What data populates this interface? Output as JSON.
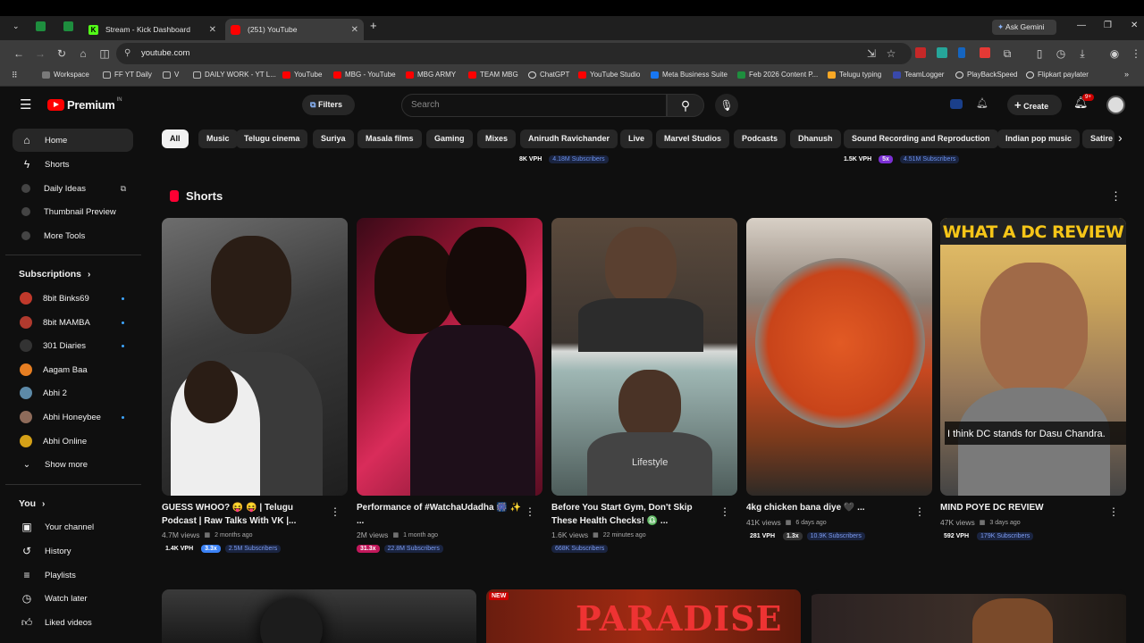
{
  "browser": {
    "tabs": [
      {
        "label": "Stream - Kick Dashboard"
      },
      {
        "label": "(251) YouTube"
      }
    ],
    "ask_gemini": "Ask Gemini",
    "url": "youtube.com",
    "bookmarks": [
      "Workspace",
      "FF YT Daily",
      "V",
      "DAILY WORK - YT L...",
      "YouTube",
      "MBG - YouTube",
      "MBG ARMY",
      "TEAM MBG",
      "ChatGPT",
      "YouTube Studio",
      "Meta Business Suite",
      "Feb 2026 Content P...",
      "Telugu typing",
      "TeamLogger",
      "PlayBackSpeed",
      "Flipkart paylater"
    ]
  },
  "header": {
    "logo_text": "Premium",
    "logo_sup": "IN",
    "filters_label": "Filters",
    "search_placeholder": "Search",
    "create_label": "Create",
    "notif_badge": "9+"
  },
  "sidebar": {
    "main": [
      {
        "label": "Home"
      },
      {
        "label": "Shorts"
      },
      {
        "label": "Daily Ideas"
      },
      {
        "label": "Thumbnail Preview"
      },
      {
        "label": "More Tools"
      }
    ],
    "subscriptions_title": "Subscriptions",
    "subscriptions": [
      {
        "label": "8bit Binks69",
        "color": "#c0392b"
      },
      {
        "label": "8bit MAMBA",
        "color": "#b03a2e"
      },
      {
        "label": "301 Diaries",
        "color": "#333333"
      },
      {
        "label": "Aagam Baa",
        "color": "#e67e22"
      },
      {
        "label": "Abhi 2",
        "color": "#5d8aa8"
      },
      {
        "label": "Abhi Honeybee",
        "color": "#8e6b5a"
      },
      {
        "label": "Abhi Online",
        "color": "#d4a017"
      }
    ],
    "show_more": "Show more",
    "you_title": "You",
    "you_items": [
      {
        "label": "Your channel"
      },
      {
        "label": "History"
      },
      {
        "label": "Playlists"
      },
      {
        "label": "Watch later"
      },
      {
        "label": "Liked videos"
      }
    ]
  },
  "chips": [
    "All",
    "Music",
    "Telugu cinema",
    "Suriya",
    "Masala films",
    "Gaming",
    "Mixes",
    "Anirudh Ravichander",
    "Live",
    "Marvel Studios",
    "Podcasts",
    "Dhanush",
    "Sound Recording and Reproduction",
    "Indian pop music",
    "Satire"
  ],
  "above_row": [
    {
      "vph": "8K VPH",
      "subs": "4.18M Subscribers"
    },
    {
      "vph": "1.5K VPH",
      "ratio": "5x",
      "subs": "4.51M Subscribers"
    }
  ],
  "shorts": {
    "title": "Shorts",
    "items": [
      {
        "title": "GUESS WHOO? 😝 😝 | Telugu Podcast | Raw Talks With VK |...",
        "views": "4.7M views",
        "age": "2 months ago",
        "vph": "1.4K VPH",
        "ratio": "3.3x",
        "ratio_color": "#3b82f6",
        "subs": "2.5M Subscribers"
      },
      {
        "title": "Performance of #WatchaUdadha 🎆 ✨ ...",
        "views": "2M views",
        "age": "1 month ago",
        "vph": "",
        "ratio": "31.3x",
        "ratio_color": "#c2185b",
        "subs": "22.8M Subscribers"
      },
      {
        "title": "Before You Start Gym, Don't Skip These Health Checks! ♎ ...",
        "views": "1.6K views",
        "age": "22 minutes ago",
        "vph": "",
        "ratio": "",
        "ratio_color": "",
        "subs": "668K Subscribers"
      },
      {
        "title": "4kg chicken bana diye 🖤 ...",
        "views": "41K views",
        "age": "6 days ago",
        "vph": "281 VPH",
        "ratio": "1.3x",
        "ratio_color": "#333333",
        "subs": "10.9K Subscribers"
      },
      {
        "title": "MIND POYE DC REVIEW",
        "views": "47K views",
        "age": "3 days ago",
        "vph": "592 VPH",
        "ratio": "",
        "ratio_color": "",
        "subs": "179K Subscribers"
      }
    ],
    "thumb5_banner": "WHAT A DC REVIEW",
    "thumb5_caption": "I think DC stands for Dasu Chandra.",
    "thumb3_watermark": "Lifestyle"
  },
  "bottom_row": {
    "new_badge": "NEW",
    "thumb2_text": "PARADISE"
  }
}
